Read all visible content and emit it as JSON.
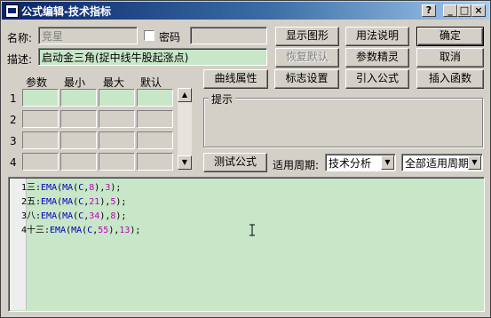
{
  "window": {
    "title": "公式编辑-技术指标",
    "help": "?",
    "minimize": "_",
    "maximize": "□",
    "close": "×"
  },
  "form": {
    "name_label": "名称:",
    "name_value": "竞星",
    "password_label": "密码",
    "password_value": "",
    "desc_label": "描述:",
    "desc_value": "启动金三角(捉中线牛股起涨点)"
  },
  "params": {
    "headers": [
      "参数",
      "最小",
      "最大",
      "默认"
    ],
    "rows": [
      "1",
      "2",
      "3",
      "4"
    ]
  },
  "buttons": {
    "show_graph": "显示图形",
    "usage": "用法说明",
    "ok": "确定",
    "restore_default": "恢复默认",
    "param_wizard": "参数精灵",
    "cancel": "取消",
    "curve_props": "曲线属性",
    "marker_settings": "标志设置",
    "import_formula": "引入公式",
    "insert_function": "插入函数",
    "test_formula": "测试公式"
  },
  "hint": {
    "label": "提示"
  },
  "period": {
    "label": "适用周期:",
    "category_selected": "技术分析",
    "period_selected": "全部适用周期"
  },
  "editor": {
    "lines": [
      {
        "num": "1",
        "name": "三",
        "inner": "8",
        "outer": "3"
      },
      {
        "num": "2",
        "name": "五",
        "inner": "21",
        "outer": "5"
      },
      {
        "num": "3",
        "name": "八",
        "inner": "34",
        "outer": "8"
      },
      {
        "num": "4",
        "name": "十三",
        "inner": "55",
        "outer": "13"
      }
    ],
    "fn_outer": "EMA",
    "fn_inner": "MA",
    "series": "C"
  }
}
